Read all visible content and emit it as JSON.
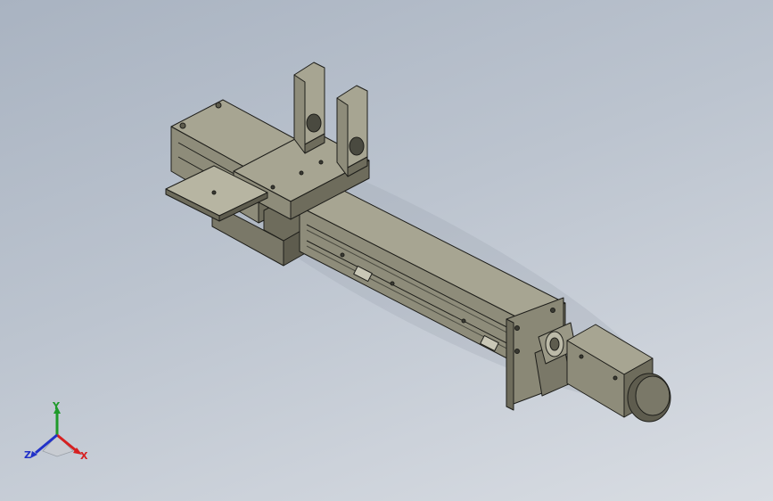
{
  "viewport": {
    "background_top": "#a9b3c1",
    "background_bottom": "#d9dde3",
    "model_color": "#8e8c7a",
    "model_light": "#a7a592",
    "model_dark": "#5e5c4e",
    "edge_color": "#1e1e1a"
  },
  "triad": {
    "x_label": "X",
    "y_label": "Y",
    "z_label": "Z",
    "x_color": "#d62020",
    "y_color": "#1f9a2a",
    "z_color": "#2232c8"
  }
}
